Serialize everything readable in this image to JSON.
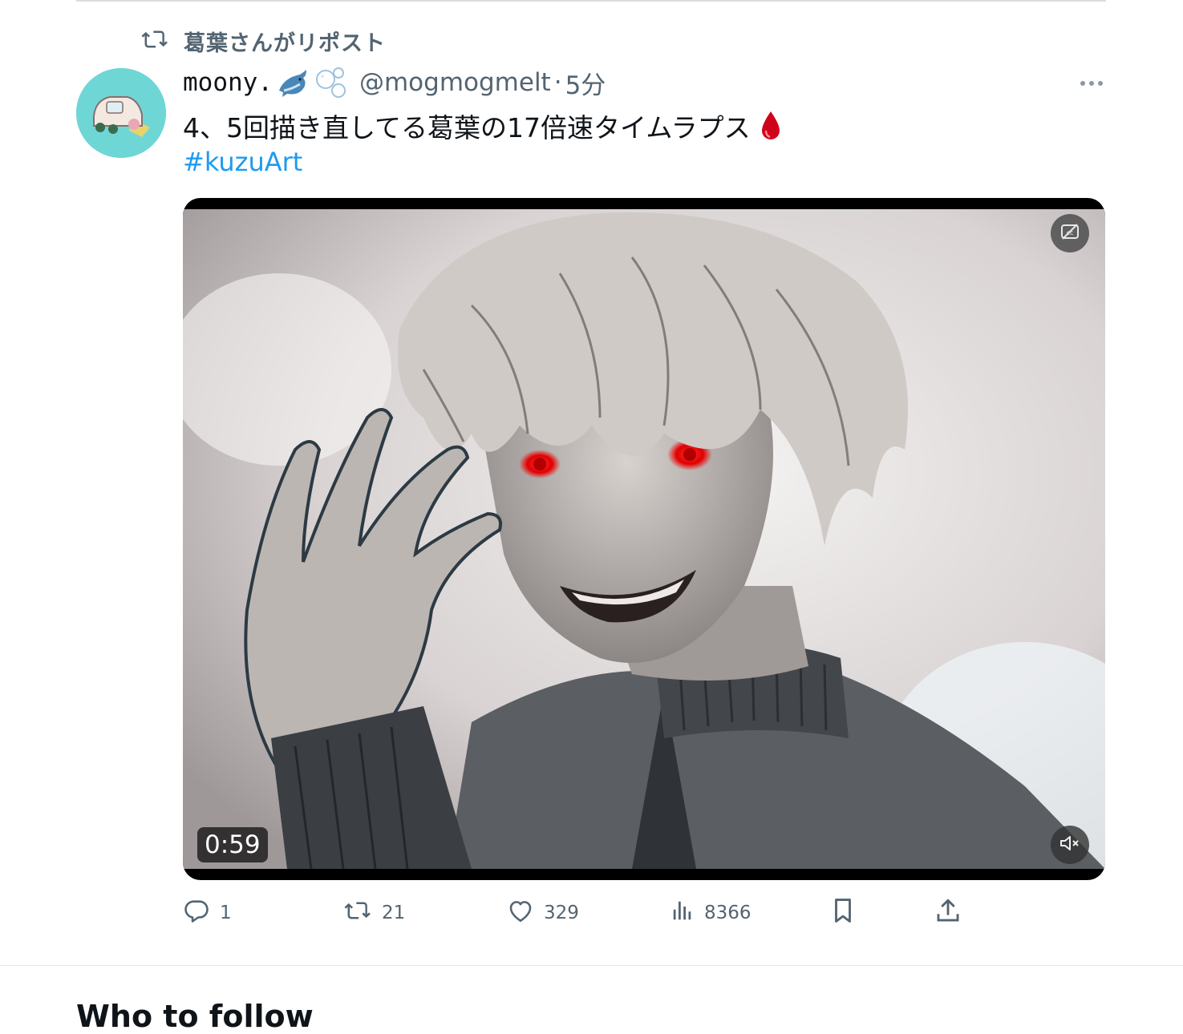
{
  "repost": {
    "label": "葛葉さんがリポスト",
    "icon": "repost-icon"
  },
  "tweet": {
    "display_name": "moony.",
    "name_emojis": [
      "dolphin-emoji",
      "bubbles-emoji"
    ],
    "handle": "@mogmogmelt",
    "separator": "·",
    "time": "5分",
    "text": "4、5回描き直してる葛葉の17倍速タイムラプス",
    "text_emoji": "drop-of-blood-emoji",
    "hashtag": "#kuzuArt"
  },
  "media": {
    "duration": "0:59",
    "cc_icon": "captions-off-icon",
    "mute_icon": "volume-muted-icon"
  },
  "actions": {
    "replies": "1",
    "reposts": "21",
    "likes": "329",
    "views": "8366"
  },
  "next_section": {
    "title": "Who to follow"
  },
  "colors": {
    "accent": "#1d9bf0",
    "secondary_text": "#536471",
    "primary_text": "#0f1419",
    "avatar_bg": "#6fd6d6"
  }
}
